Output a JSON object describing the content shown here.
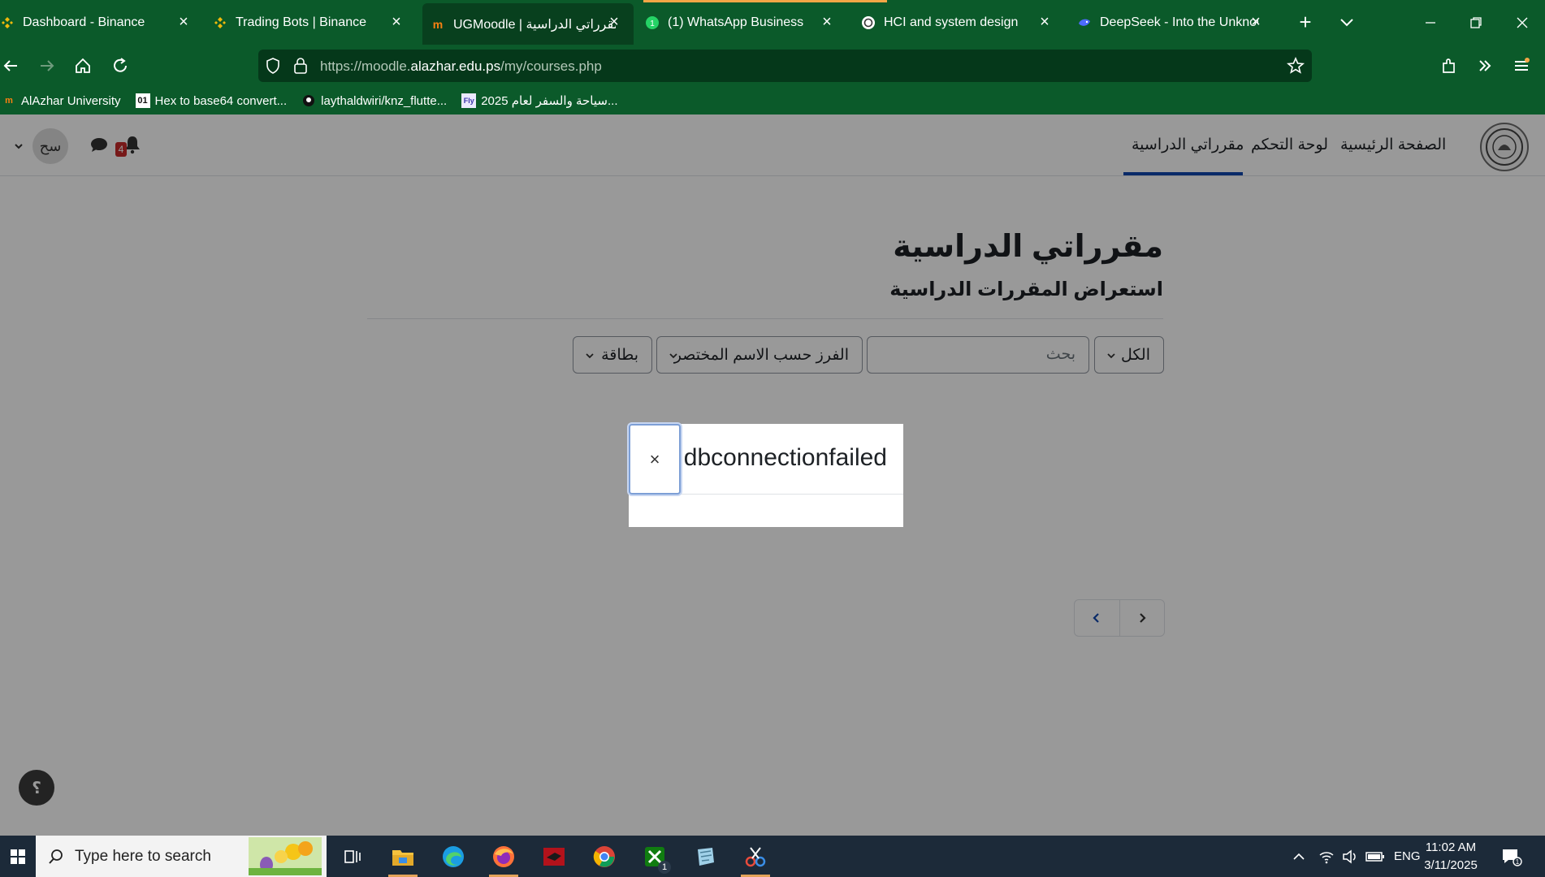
{
  "browser": {
    "tabs": [
      {
        "title": "Dashboard - Binance",
        "icon": "binance-icon"
      },
      {
        "title": "Trading Bots | Binance",
        "icon": "binance-icon"
      },
      {
        "title": "UGMoodle | مقرراتي الدراسية",
        "icon": "moodle-icon",
        "active": true
      },
      {
        "title": "(1) WhatsApp Business",
        "icon": "whatsapp-icon"
      },
      {
        "title": "HCI and system design",
        "icon": "chatgpt-icon"
      },
      {
        "title": "DeepSeek - Into the Unknown",
        "icon": "deepseek-icon"
      }
    ],
    "url": {
      "prefix": "https://moodle.",
      "domain": "alazhar.edu.ps",
      "path": "/my/courses.php"
    },
    "bookmarks": [
      {
        "label": "AlAzhar University",
        "icon": "moodle-icon"
      },
      {
        "label": "Hex to base64 convert...",
        "icon": "hex-icon"
      },
      {
        "label": "laythaldwiri/knz_flutte...",
        "icon": "github-icon"
      },
      {
        "label": "2025 سياحة والسفر لعام...",
        "icon": "fly-icon"
      }
    ],
    "colors": {
      "chrome": "#0b5a2a",
      "active_tab": "#08401e",
      "urlbar": "#05381a"
    }
  },
  "site": {
    "nav": {
      "home": "الصفحة الرئيسية",
      "dashboard": "لوحة التحكم",
      "my_courses": "مقرراتي الدراسية"
    },
    "user": {
      "initials": "سح",
      "notification_count": "4"
    },
    "accent": "#0f47ad"
  },
  "page": {
    "title": "مقرراتي الدراسية",
    "subtitle": "استعراض المقررات الدراسية",
    "filters": {
      "grouping": "الكل",
      "search_placeholder": "بحث",
      "sort": "الفرز حسب الاسم المختصر",
      "view": "بطاقة"
    },
    "help_label": "؟"
  },
  "modal": {
    "title": "dbconnectionfailed",
    "close_label": "×"
  },
  "taskbar": {
    "search_placeholder": "Type here to search",
    "tray": {
      "language": "ENG",
      "time": "11:02 AM",
      "date": "3/11/2025"
    },
    "badge_count": "1"
  }
}
